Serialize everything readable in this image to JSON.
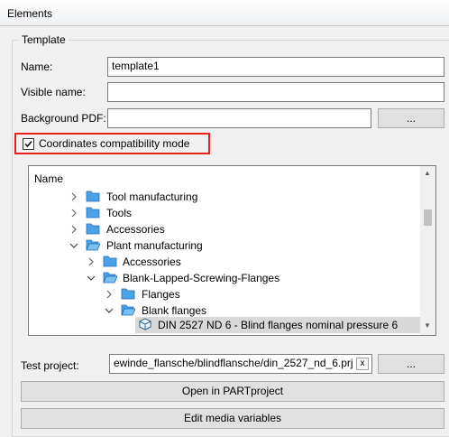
{
  "window": {
    "title": "Elements"
  },
  "group": {
    "label": "Template"
  },
  "form": {
    "name_label": "Name:",
    "name_value": "template1",
    "visible_name_label": "Visible name:",
    "visible_name_value": "",
    "background_pdf_label": "Background PDF:",
    "background_pdf_value": "",
    "browse_label": "...",
    "compat_label": "Coordinates compatibility mode",
    "compat_checked": true
  },
  "tree": {
    "header": "Name",
    "items": [
      {
        "label": "Tool manufacturing"
      },
      {
        "label": "Tools"
      },
      {
        "label": "Accessories"
      },
      {
        "label": "Plant manufacturing"
      },
      {
        "label": "Accessories"
      },
      {
        "label": "Blank-Lapped-Screwing-Flanges"
      },
      {
        "label": "Flanges"
      },
      {
        "label": "Blank flanges"
      },
      {
        "label": "DIN 2527 ND 6 - Blind flanges nominal pressure 6"
      }
    ]
  },
  "test_project": {
    "label": "Test project:",
    "value": "ewinde_flansche/blindflansche/din_2527_nd_6.prj",
    "clear_label": "x",
    "browse_label": "..."
  },
  "buttons": {
    "open_label": "Open in PARTproject",
    "media_label": "Edit media variables"
  },
  "colors": {
    "highlight": "#e8211a",
    "folder": "#4aa3e8"
  }
}
